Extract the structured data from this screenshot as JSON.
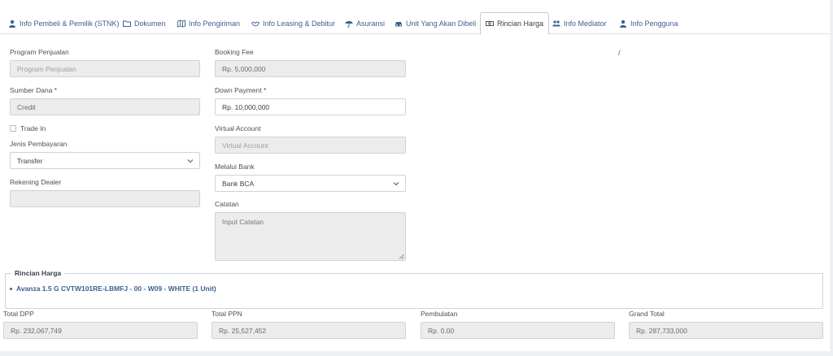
{
  "tabs": [
    {
      "label": "Info Pembeli & Pemilik (STNK)",
      "icon": "user-icon"
    },
    {
      "label": "Dokumen",
      "icon": "folder-icon"
    },
    {
      "label": "Info Pengiriman",
      "icon": "map-icon"
    },
    {
      "label": "Info Leasing & Debitur",
      "icon": "handshake-icon"
    },
    {
      "label": "Asuransi",
      "icon": "umbrella-icon"
    },
    {
      "label": "Unit Yang Akan Dibeli",
      "icon": "car-icon"
    },
    {
      "label": "Rincian Harga",
      "icon": "money-icon",
      "active": true
    },
    {
      "label": "Info Mediator",
      "icon": "users-icon"
    },
    {
      "label": "Info Pengguna",
      "icon": "user-icon"
    }
  ],
  "left": {
    "program_label": "Program Penjualan",
    "program_placeholder": "Program Penjualan",
    "sumber_label": "Sumber Dana *",
    "sumber_value": "Credit",
    "tradein_label": "Trade In",
    "jenis_label": "Jenis Pembayaran",
    "jenis_value": "Transfer",
    "rekening_label": "Rekening Dealer",
    "rekening_value": ""
  },
  "middle": {
    "booking_label": "Booking Fee",
    "booking_value": "Rp. 5,000,000",
    "dp_label": "Down Payment *",
    "dp_value": "Rp. 10,000,000",
    "va_label": "Virtual Account",
    "va_placeholder": "Virtual Account",
    "bank_label": "Melalui Bank",
    "bank_value": "Bank BCA",
    "catatan_label": "Catatan",
    "catatan_placeholder": "Input Catatan"
  },
  "separator": "/",
  "rincian": {
    "legend": "Rincian Harga",
    "items": [
      "Avanza 1.5 G CVTW101RE-LBMFJ - 00 - W09 - WHITE (1 Unit)"
    ]
  },
  "totals": {
    "dpp_label": "Total DPP",
    "dpp_value": "Rp. 232,067,749",
    "ppn_label": "Total PPN",
    "ppn_value": "Rp. 25,527,452",
    "pembulatan_label": "Pembulatan",
    "pembulatan_value": "Rp. 0.00",
    "grand_label": "Grand Total",
    "grand_value": "Rp. 287,733,000"
  },
  "colors": {
    "accent": "#3d5f92",
    "field_bg": "#ececec",
    "page_bg": "#eef0f3"
  }
}
